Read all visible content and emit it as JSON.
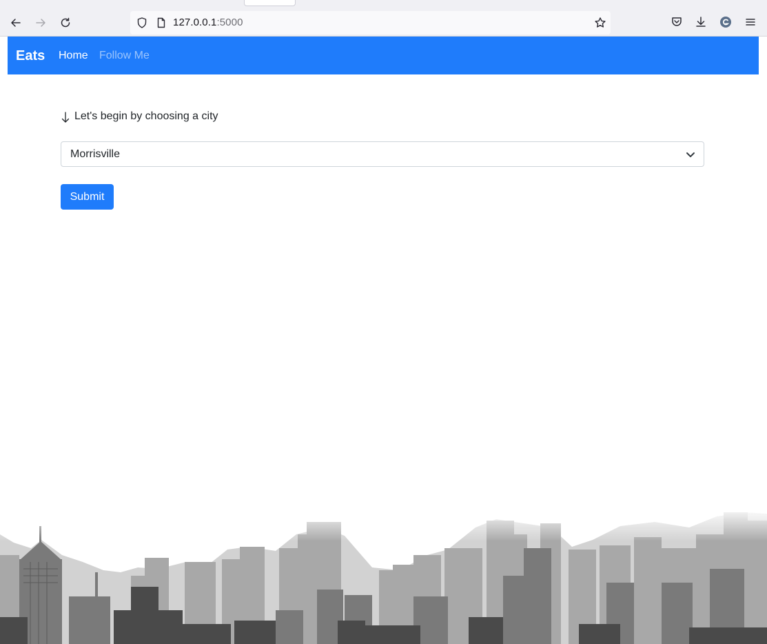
{
  "browser": {
    "url_host": "127.0.0.1",
    "url_port": ":5000"
  },
  "navbar": {
    "brand": "Eats",
    "links": [
      {
        "label": "Home"
      },
      {
        "label": "Follow Me"
      }
    ]
  },
  "main": {
    "prompt": "Let's begin by choosing a city",
    "city_select": {
      "value": "Morrisville"
    },
    "submit_label": "Submit"
  },
  "colors": {
    "primary": "#1f7cfb",
    "text": "#212529"
  }
}
